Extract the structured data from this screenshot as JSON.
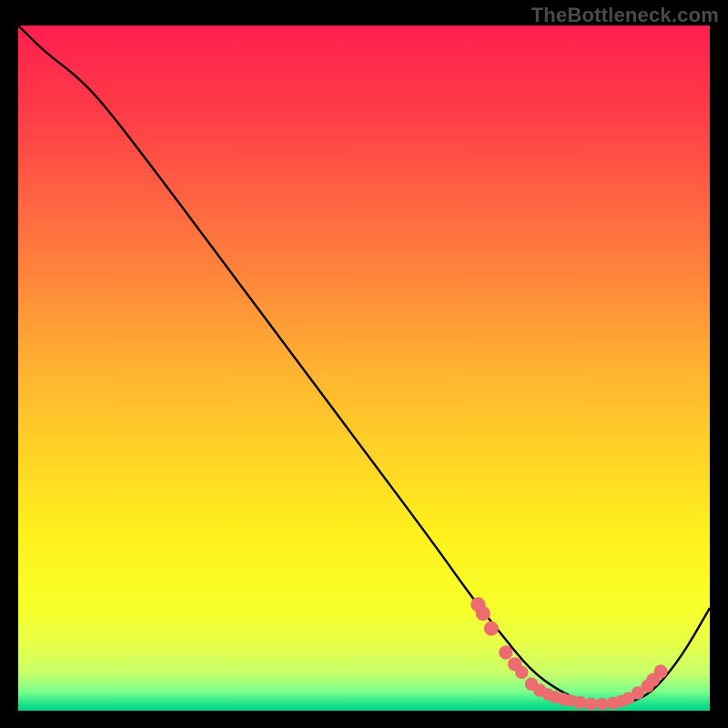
{
  "watermark": "TheBottleneck.com",
  "colors": {
    "bg_black": "#000000",
    "curve": "#000000",
    "dot": "#ec6c6f",
    "gradient_stops": [
      {
        "offset": 0.0,
        "color": "#ff1f4e"
      },
      {
        "offset": 0.12,
        "color": "#ff3a48"
      },
      {
        "offset": 0.25,
        "color": "#ff6242"
      },
      {
        "offset": 0.38,
        "color": "#ff8a3a"
      },
      {
        "offset": 0.5,
        "color": "#ffb231"
      },
      {
        "offset": 0.62,
        "color": "#ffd226"
      },
      {
        "offset": 0.74,
        "color": "#fff01d"
      },
      {
        "offset": 0.85,
        "color": "#f7ff28"
      },
      {
        "offset": 0.905,
        "color": "#e6ff4a"
      },
      {
        "offset": 0.945,
        "color": "#c8ff6a"
      },
      {
        "offset": 0.972,
        "color": "#7dff8d"
      },
      {
        "offset": 0.992,
        "color": "#13e08a"
      },
      {
        "offset": 1.0,
        "color": "#0fd487"
      }
    ]
  },
  "chart_data": {
    "type": "line",
    "title": "",
    "xlabel": "",
    "ylabel": "",
    "xlim": [
      0,
      100
    ],
    "ylim": [
      0,
      100
    ],
    "legend": false,
    "grid": false,
    "series": [
      {
        "name": "bottleneck-curve",
        "x": [
          0,
          4,
          8,
          12,
          20,
          30,
          40,
          50,
          60,
          66,
          70,
          74,
          78,
          82,
          86,
          89,
          92,
          96,
          100
        ],
        "y": [
          100,
          96,
          93,
          89,
          78.5,
          65,
          51.5,
          38,
          24.5,
          16,
          11,
          6,
          3,
          1.2,
          1,
          1.3,
          3,
          8,
          15
        ]
      }
    ],
    "scatter_overlay": {
      "name": "dots",
      "points": [
        {
          "x": 66.5,
          "y": 15.5,
          "r": 1.2
        },
        {
          "x": 67.2,
          "y": 14.2,
          "r": 1.2
        },
        {
          "x": 68.4,
          "y": 12.0,
          "r": 1.2
        },
        {
          "x": 70.5,
          "y": 8.5,
          "r": 1.1
        },
        {
          "x": 71.8,
          "y": 6.8,
          "r": 1.1
        },
        {
          "x": 72.8,
          "y": 5.6,
          "r": 1.0
        },
        {
          "x": 74.2,
          "y": 3.9,
          "r": 1.0
        },
        {
          "x": 75.4,
          "y": 3.0,
          "r": 1.0
        },
        {
          "x": 76.6,
          "y": 2.4,
          "r": 0.9
        },
        {
          "x": 77.6,
          "y": 2.0,
          "r": 0.9
        },
        {
          "x": 78.8,
          "y": 1.7,
          "r": 0.95
        },
        {
          "x": 79.8,
          "y": 1.5,
          "r": 0.9
        },
        {
          "x": 81.2,
          "y": 1.2,
          "r": 1.0
        },
        {
          "x": 82.8,
          "y": 1.0,
          "r": 0.95
        },
        {
          "x": 84.4,
          "y": 1.0,
          "r": 0.9
        },
        {
          "x": 86.0,
          "y": 1.1,
          "r": 0.95
        },
        {
          "x": 87.2,
          "y": 1.4,
          "r": 0.9
        },
        {
          "x": 88.2,
          "y": 1.8,
          "r": 0.95
        },
        {
          "x": 89.6,
          "y": 2.6,
          "r": 1.0
        },
        {
          "x": 91.0,
          "y": 3.6,
          "r": 1.0
        },
        {
          "x": 91.8,
          "y": 4.5,
          "r": 1.05
        },
        {
          "x": 92.9,
          "y": 5.7,
          "r": 1.1
        }
      ]
    }
  }
}
